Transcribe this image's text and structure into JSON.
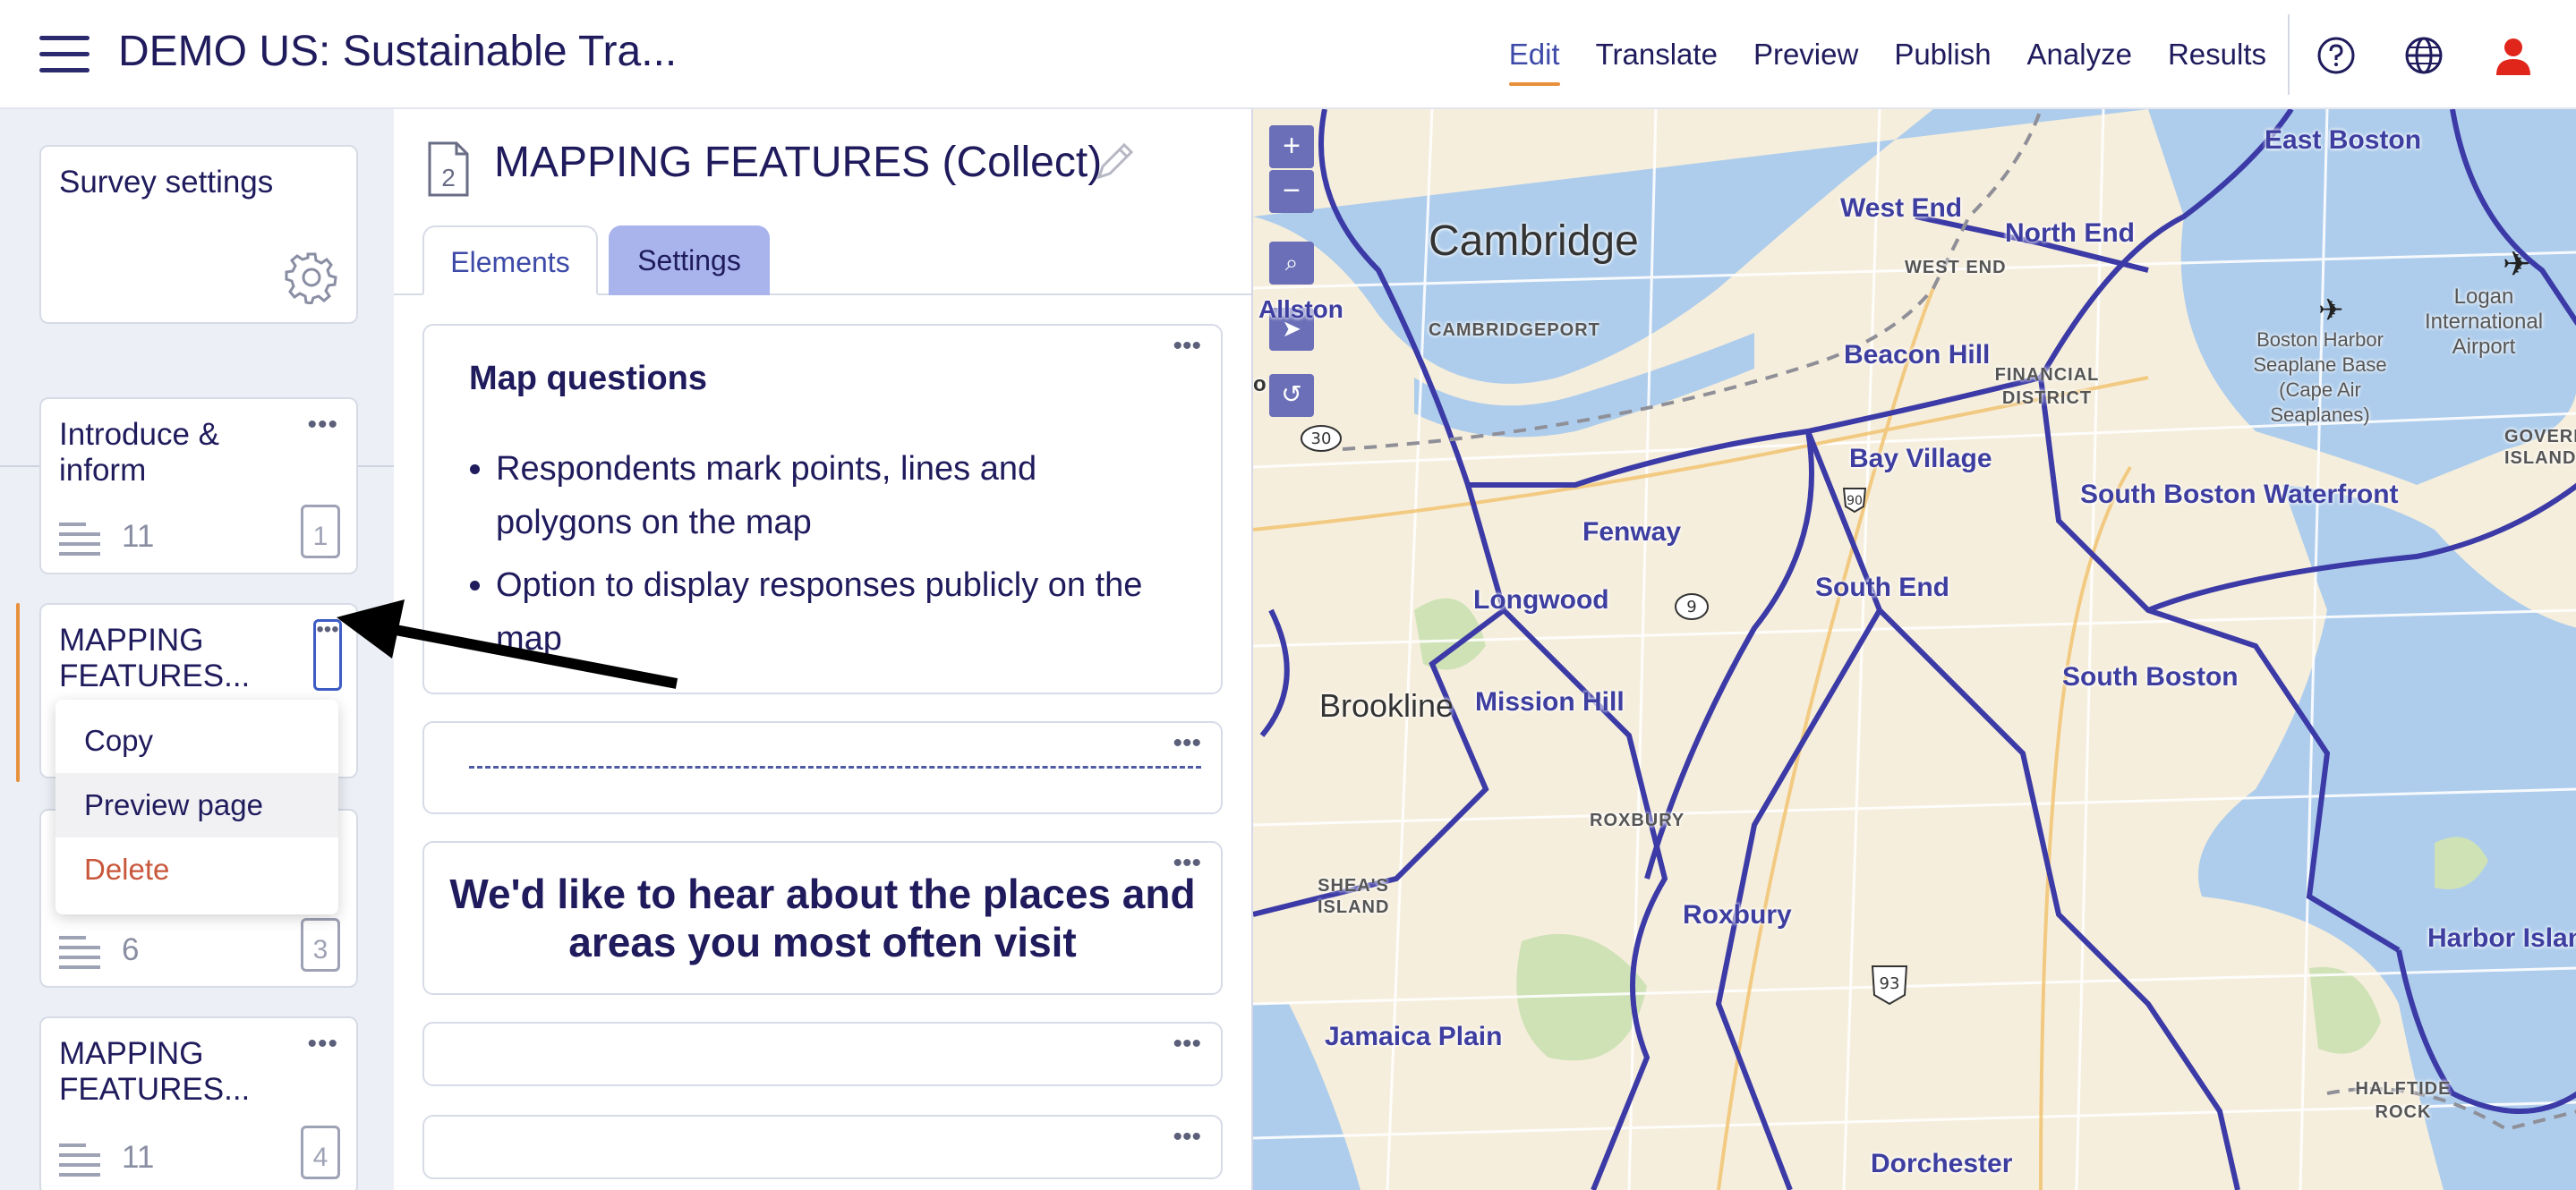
{
  "header": {
    "survey_title": "DEMO US: Sustainable Tra...",
    "nav": [
      "Edit",
      "Translate",
      "Preview",
      "Publish",
      "Analyze",
      "Results"
    ],
    "active_nav": "Edit",
    "icons": [
      "help-icon",
      "globe-icon",
      "user-icon"
    ]
  },
  "sidebar": {
    "survey_settings": {
      "label": "Survey settings",
      "icon": "gear-icon"
    },
    "pages": [
      {
        "title": "Introduce & inform",
        "count": "11",
        "page": "1"
      },
      {
        "title": "MAPPING FEATURES...",
        "count": "",
        "page": "2"
      },
      {
        "title": "",
        "count": "6",
        "page": "3"
      },
      {
        "title": "MAPPING FEATURES...",
        "count": "11",
        "page": "4"
      }
    ],
    "context_menu": {
      "copy": "Copy",
      "preview": "Preview page",
      "delete": "Delete"
    }
  },
  "editor": {
    "page_number": "2",
    "page_title": "MAPPING FEATURES (Collect)",
    "tabs": {
      "elements": "Elements",
      "settings": "Settings"
    },
    "elements": {
      "map_questions_heading": "Map questions",
      "map_questions_bullets": [
        "Respondents mark points, lines and polygons on the map",
        "Option to display responses publicly on the map"
      ],
      "big_heading": "We'd like to hear about the places and areas you most often visit"
    }
  },
  "map": {
    "controls": {
      "zoom_in": "+",
      "zoom_out": "−"
    },
    "labels": {
      "cambridge": "Cambridge",
      "cambridgeport": "CAMBRIDGEPORT",
      "allston": "Allston",
      "west_end": "West End",
      "west_end_small": "WEST END",
      "north_end": "North End",
      "east_boston": "East Boston",
      "beacon_hill": "Beacon Hill",
      "financial_district": "FINANCIAL DISTRICT",
      "bay_village": "Bay Village",
      "south_boston_waterfront": "South Boston Waterfront",
      "fenway": "Fenway",
      "south_end": "South End",
      "longwood": "Longwood",
      "brookline": "Brookline",
      "mission_hill": "Mission Hill",
      "south_boston": "South Boston",
      "roxbury_small": "ROXBURY",
      "roxbury": "Roxbury",
      "sheas_island": "SHEA'S ISLAND",
      "jamaica_plain": "Jamaica Plain",
      "dorchester": "Dorchester",
      "harbor_islands": "Harbor Island",
      "halftide_rock": "HALFTIDE ROCK",
      "logan": "Logan International Airport",
      "seaplane": "Boston Harbor Seaplane Base (Cape Air Seaplanes)",
      "governors_island": "GOVERNORS ISLAND",
      "route_30": "30",
      "route_9": "9",
      "route_93": "93",
      "route_90": "90",
      "o_label": "o"
    }
  }
}
